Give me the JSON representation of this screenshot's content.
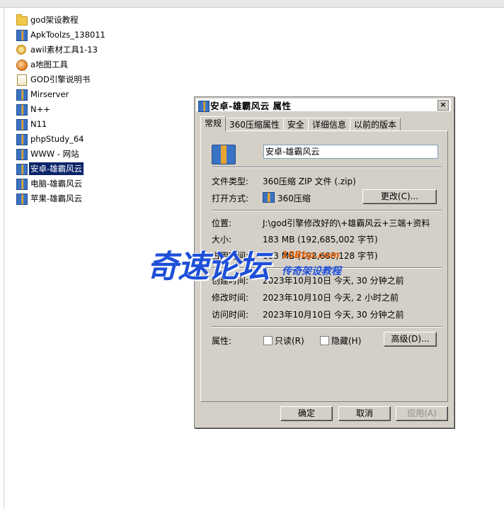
{
  "files": [
    {
      "name": "god架设教程",
      "icon": "folder-icon"
    },
    {
      "name": "ApkToolzs_138011",
      "icon": "zip-archive-icon"
    },
    {
      "name": "awil素材工具1-13",
      "icon": "app-icon"
    },
    {
      "name": "a地图工具",
      "icon": "map-tool-icon"
    },
    {
      "name": "GOD引擎说明书",
      "icon": "document-icon"
    },
    {
      "name": "Mirserver",
      "icon": "zip-archive-icon"
    },
    {
      "name": "N++",
      "icon": "zip-archive-icon"
    },
    {
      "name": "N11",
      "icon": "zip-archive-icon"
    },
    {
      "name": "phpStudy_64",
      "icon": "zip-archive-icon"
    },
    {
      "name": "WWW - 网站",
      "icon": "zip-archive-icon"
    },
    {
      "name": "安卓-雄霸风云",
      "icon": "zip-archive-icon",
      "selected": true
    },
    {
      "name": "电脑-雄霸风云",
      "icon": "zip-archive-icon"
    },
    {
      "name": "苹果-雄霸风云",
      "icon": "zip-archive-icon"
    }
  ],
  "dialog": {
    "title": "安卓-雄霸风云 属性",
    "close": "×",
    "tabs": [
      "常规",
      "360压缩属性",
      "安全",
      "详细信息",
      "以前的版本"
    ],
    "name_value": "安卓-雄霸风云",
    "file_type_label": "文件类型:",
    "file_type_value": "360压缩 ZIP 文件 (.zip)",
    "open_with_label": "打开方式:",
    "open_with_value": "360压缩",
    "change_button": "更改(C)...",
    "location_label": "位置:",
    "location_value": "J:\\god引擎修改好的\\+雄霸风云+三端+资料",
    "size_label": "大小:",
    "size_value": "183 MB (192,685,002 字节)",
    "disk_size_label": "占用空间:",
    "disk_size_value": "183 MB (192,688,128 字节)",
    "created_label": "创建时间:",
    "created_value": "2023年10月10日 今天, 30 分钟之前",
    "modified_label": "修改时间:",
    "modified_value": "2023年10月10日 今天, 2 小时之前",
    "accessed_label": "访问时间:",
    "accessed_value": "2023年10月10日 今天, 30 分钟之前",
    "attributes_label": "属性:",
    "readonly_label": "只读(R)",
    "hidden_label": "隐藏(H)",
    "advanced_button": "高级(D)...",
    "ok_button": "确定",
    "cancel_button": "取消",
    "apply_button": "应用(A)"
  },
  "watermark": {
    "main": "奇速论坛",
    "url": "10Bbp.com",
    "sub": "传奇架设教程"
  },
  "colors": {
    "selection": "#0a246a",
    "dialog_face": "#d4d0c8",
    "watermark_blue": "#1e4fd8",
    "watermark_orange": "#e2620a"
  }
}
